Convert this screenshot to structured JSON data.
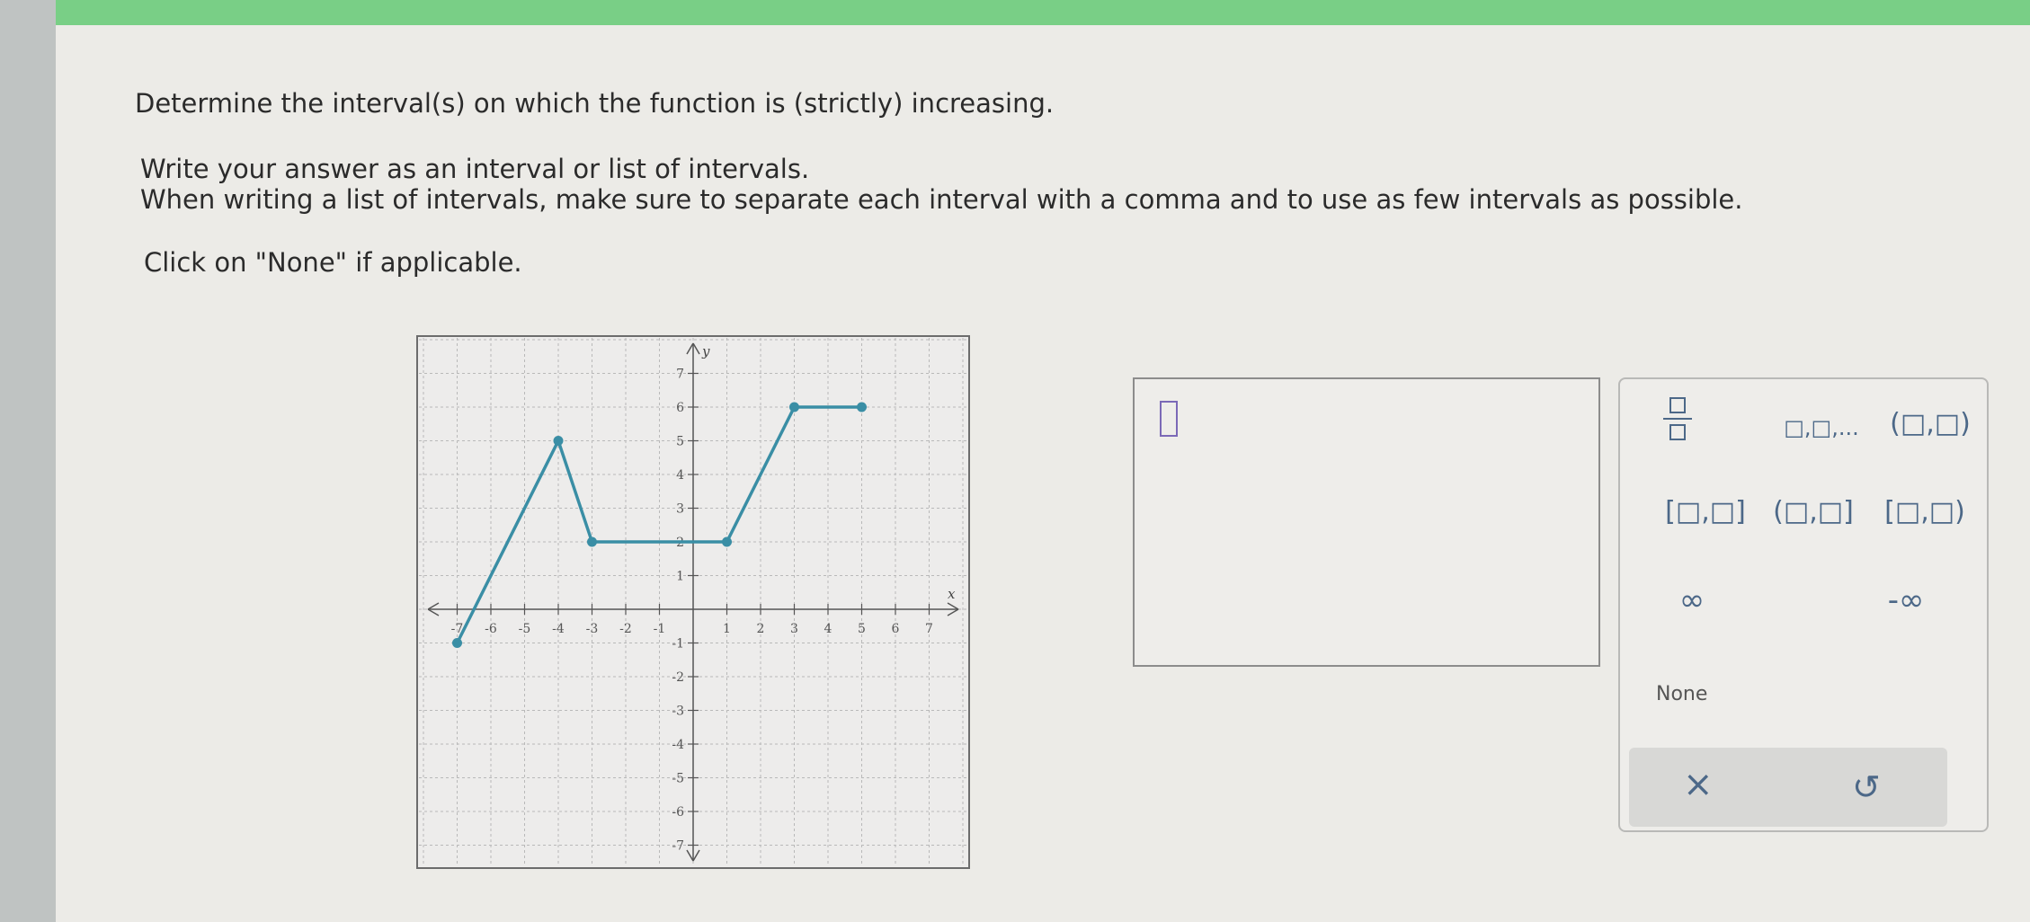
{
  "question": {
    "line1": "Determine the interval(s) on which the function is (strictly) increasing.",
    "line2": "Write your answer as an interval or list of intervals.",
    "line3": "When writing a list of intervals, make sure to separate each interval with a comma and to use as few intervals as possible.",
    "line4": "Click on \"None\" if applicable."
  },
  "chart_data": {
    "type": "line",
    "xlabel": "x",
    "ylabel": "y",
    "xlim": [
      -8,
      8
    ],
    "ylim": [
      -8,
      8
    ],
    "xticks": [
      "-7",
      "-6",
      "-5",
      "-4",
      "-3",
      "-2",
      "-1",
      "1",
      "2",
      "3",
      "4",
      "5",
      "6",
      "7"
    ],
    "yticks": [
      "7",
      "6",
      "5",
      "4",
      "3",
      "2",
      "1",
      "-1",
      "-2",
      "-3",
      "-4",
      "-5",
      "-6",
      "-7"
    ],
    "grid": true,
    "line_color": "#3a8ea5",
    "points": [
      [
        -7,
        -1
      ],
      [
        -4,
        5
      ],
      [
        -3,
        2
      ],
      [
        1,
        2
      ],
      [
        3,
        6
      ],
      [
        5,
        6
      ]
    ]
  },
  "answer": {
    "value": ""
  },
  "keypad": {
    "frac_label": "□/□",
    "list_label": "□,□,...",
    "open_open": "(□,□)",
    "closed_closed": "[□,□]",
    "open_closed": "(□,□]",
    "closed_open": "[□,□)",
    "infinity": "∞",
    "neg_infinity": "-∞",
    "none": "None",
    "clear": "×",
    "undo": "↺"
  }
}
